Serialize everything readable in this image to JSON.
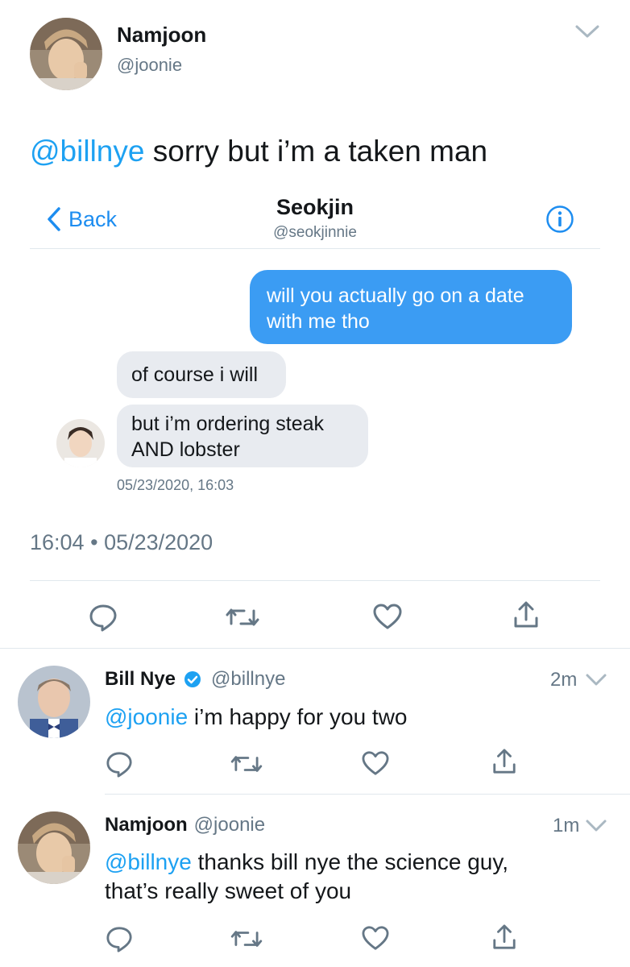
{
  "main_tweet": {
    "author_name": "Namjoon",
    "author_handle": "@joonie",
    "text_mention": "@billnye",
    "text_body": " sorry but i’m a taken man",
    "timestamp_time": "16:04",
    "timestamp_sep": "•",
    "timestamp_date": "05/23/2020"
  },
  "dm_screenshot": {
    "back_label": "Back",
    "contact_name": "Seokjin",
    "contact_handle": "@seokjinnie",
    "messages": [
      {
        "from": "me",
        "text_line1": "will you actually go on a date",
        "text_line2": "with me tho"
      },
      {
        "from": "them",
        "text": "of course i will"
      },
      {
        "from": "them",
        "text_line1": "but i’m ordering steak",
        "text_line2": "AND lobster"
      }
    ],
    "message_timestamp": "05/23/2020, 16:03",
    "colors": {
      "sent_bubble": "#3b9cf3",
      "received_bubble": "#e8ebf0"
    }
  },
  "replies": [
    {
      "author_name": "Bill Nye",
      "verified": true,
      "author_handle": "@billnye",
      "time": "2m",
      "mention": "@joonie",
      "text": " i’m happy for you two"
    },
    {
      "author_name": "Namjoon",
      "verified": false,
      "author_handle": "@joonie",
      "time": "1m",
      "mention": "@billnye",
      "text_line1": " thanks bill nye the science guy,",
      "text_line2": "that’s really sweet of you"
    }
  ],
  "actions": [
    "reply-icon",
    "retweet-icon",
    "like-icon",
    "share-icon"
  ],
  "colors": {
    "link": "#1da1f2",
    "muted": "#657786",
    "separator": "#e1e8ed"
  }
}
